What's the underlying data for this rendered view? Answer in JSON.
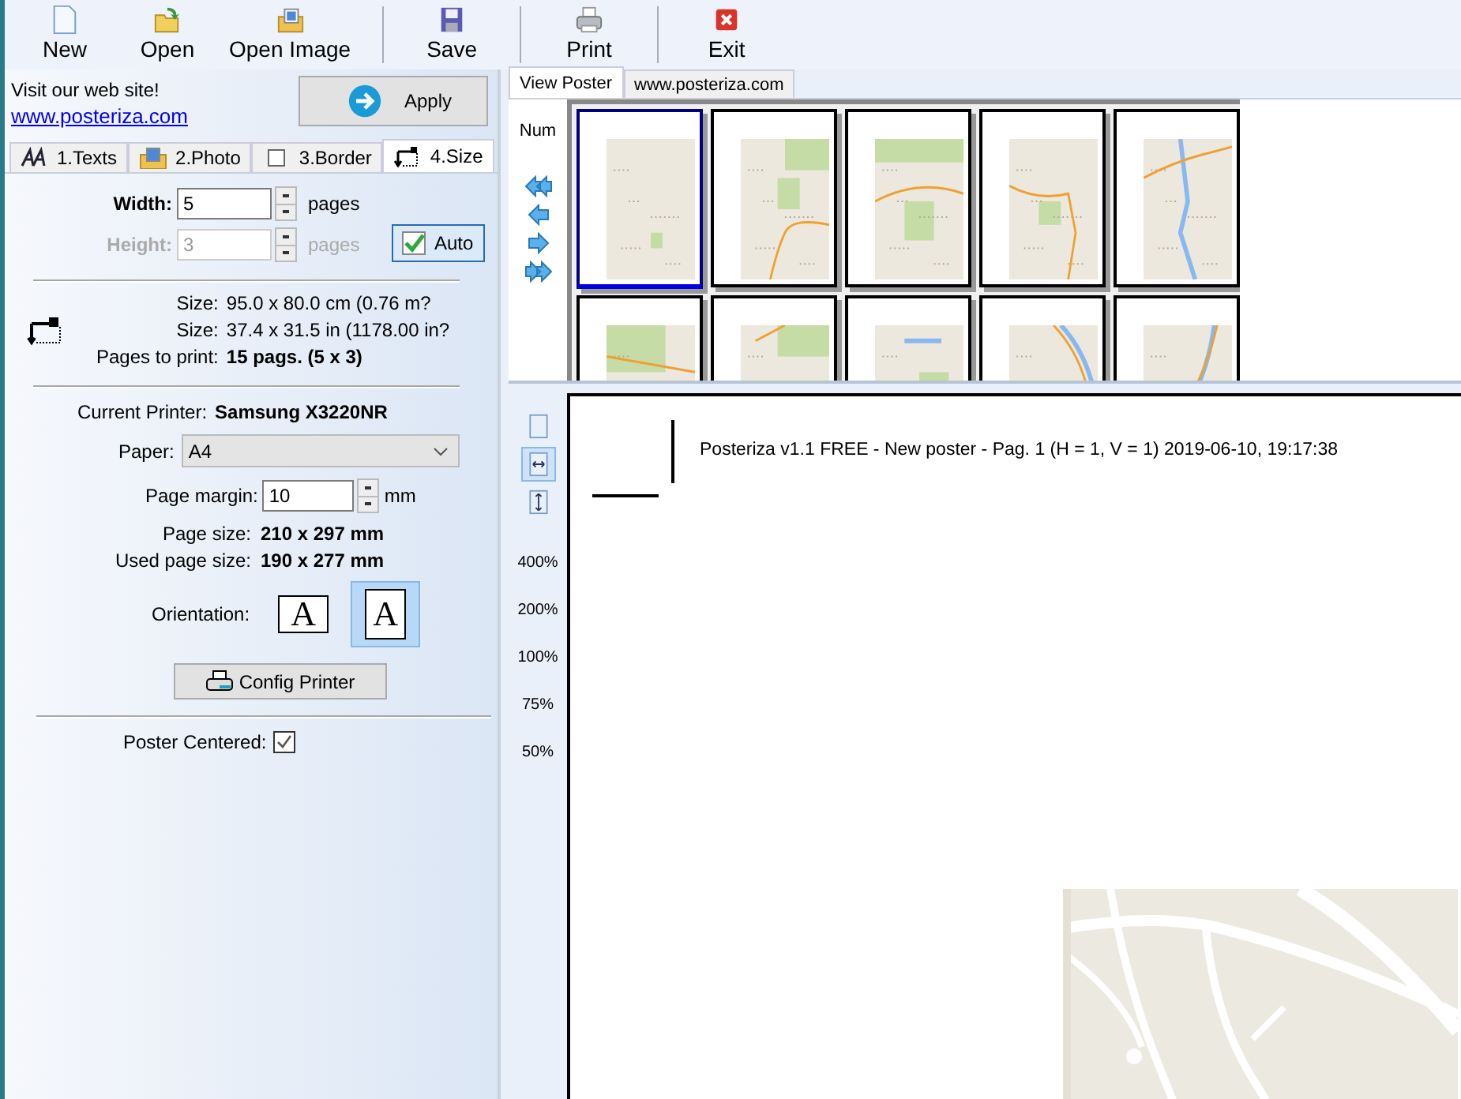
{
  "toolbar": {
    "groups": [
      [
        "New",
        "Open",
        "Open Image"
      ],
      [
        "Save"
      ],
      [
        "Print"
      ],
      [
        "Exit"
      ]
    ]
  },
  "left_panel": {
    "website": {
      "text": "Visit our web site!",
      "link": "www.posteriza.com"
    },
    "apply_button": "Apply",
    "tabs": [
      {
        "label": "1.Texts",
        "selected": false
      },
      {
        "label": "2.Photo",
        "selected": false
      },
      {
        "label": "3.Border",
        "selected": false
      },
      {
        "label": "4.Size",
        "selected": true
      }
    ],
    "pages": [
      {
        "label": "Width:",
        "value": "5",
        "unit": "pages",
        "disabled": false
      },
      {
        "label": "Height:",
        "value": "3",
        "unit": "pages",
        "disabled": true
      }
    ],
    "auto_button": {
      "label": "Auto",
      "checked": true
    },
    "size_info": [
      {
        "label": "Size:",
        "value": "95.0 x 80.0 cm (0.76 m?",
        "emphasis": false
      },
      {
        "label": "Size:",
        "value": "37.4 x 31.5 in (1178.00 in?",
        "emphasis": false
      },
      {
        "label": "Pages to print:",
        "value": "15 pags. (5 x 3)",
        "emphasis": true
      }
    ],
    "printer": {
      "label": "Current Printer:",
      "value": "Samsung X3220NR"
    },
    "paper": {
      "label": "Paper:",
      "value": "A4"
    },
    "margin": {
      "label": "Page margin:",
      "value": "10",
      "unit": "mm"
    },
    "page_sizes": [
      {
        "label": "Page size:",
        "value": "210 x 297 mm"
      },
      {
        "label": "Used page size:",
        "value": "190 x 277 mm"
      }
    ],
    "orientation": {
      "label": "Orientation:",
      "options": [
        {
          "glyph": "A",
          "selected": false
        },
        {
          "glyph": "A",
          "selected": true
        }
      ]
    },
    "config_button": "Config Printer",
    "poster_centered": {
      "label": "Poster Centered:",
      "checked": true
    }
  },
  "right_panel": {
    "tabs": [
      {
        "label": "View Poster",
        "selected": true
      },
      {
        "label": "www.posteriza.com",
        "selected": false
      }
    ],
    "num_label": "Num",
    "thumbnails": [
      {
        "selected": true
      },
      {
        "selected": false
      },
      {
        "selected": false
      },
      {
        "selected": false
      },
      {
        "selected": false
      },
      {
        "selected": false
      },
      {
        "selected": false
      },
      {
        "selected": false
      },
      {
        "selected": false
      },
      {
        "selected": false
      }
    ],
    "view_modes": [
      {
        "selected": false
      },
      {
        "selected": true
      },
      {
        "selected": false
      }
    ],
    "zoom_levels": [
      "400%",
      "200%",
      "100%",
      "75%",
      "50%"
    ],
    "preview": {
      "header": "Posteriza v1.1 FREE - New poster - Pag. 1 (H = 1, V = 1) 2019-06-10, 19:17:38"
    }
  }
}
